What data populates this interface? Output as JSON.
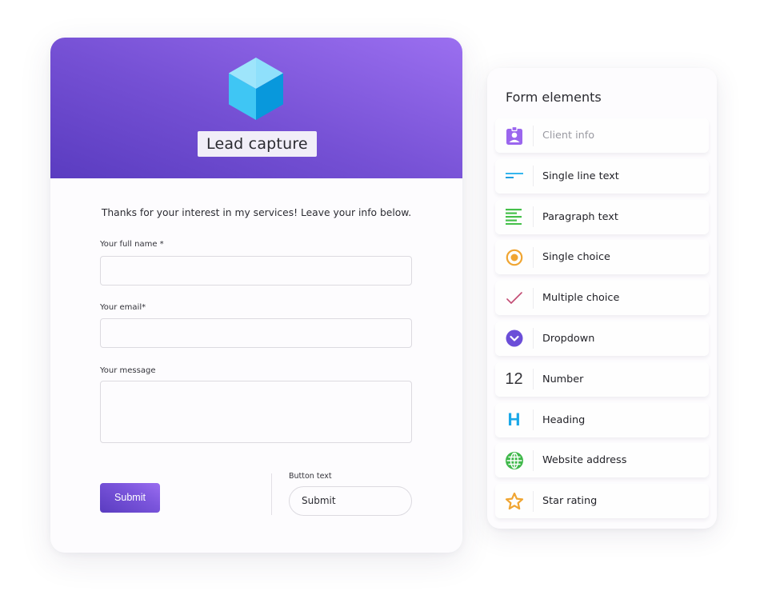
{
  "form": {
    "title": "Lead capture",
    "intro": "Thanks for your interest in my services! Leave your info below.",
    "fields": [
      {
        "label": "Your full name *",
        "value": "",
        "type": "text"
      },
      {
        "label": "Your email*",
        "value": "",
        "type": "email"
      },
      {
        "label": "Your message",
        "value": "",
        "type": "textarea"
      }
    ],
    "submit_label": "Submit",
    "button_text_label": "Button text",
    "button_text_value": "Submit"
  },
  "panel": {
    "title": "Form elements",
    "items": [
      {
        "label": "Client info",
        "icon": "client-info-icon",
        "muted": true
      },
      {
        "label": "Single line text",
        "icon": "single-line-text-icon"
      },
      {
        "label": "Paragraph text",
        "icon": "paragraph-text-icon"
      },
      {
        "label": "Single choice",
        "icon": "radio-icon"
      },
      {
        "label": "Multiple choice",
        "icon": "checkmark-icon"
      },
      {
        "label": "Dropdown",
        "icon": "dropdown-icon"
      },
      {
        "label": "Number",
        "icon": "number-icon",
        "glyph": "12"
      },
      {
        "label": "Heading",
        "icon": "heading-icon",
        "glyph": "H"
      },
      {
        "label": "Website address",
        "icon": "globe-icon"
      },
      {
        "label": "Star rating",
        "icon": "star-icon"
      }
    ]
  },
  "colors": {
    "accent": "#7550d4",
    "header_start": "#5a3cc0",
    "header_end": "#9b6ff0",
    "cube": "#3fc6f4"
  }
}
